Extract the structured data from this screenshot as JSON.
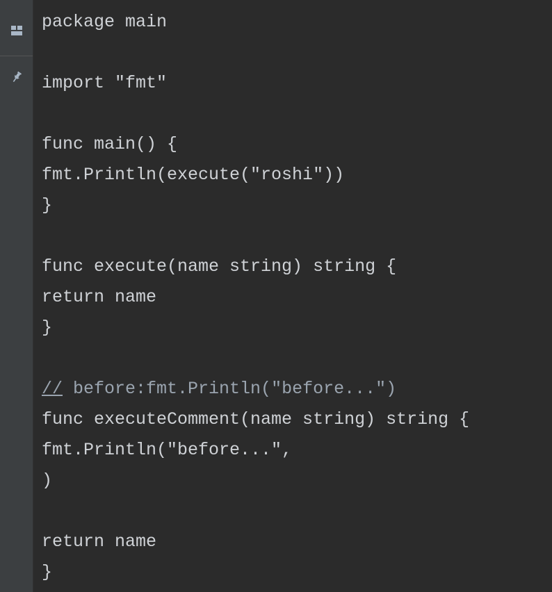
{
  "gutter": {
    "layout_icon": "layout-icon",
    "pin_icon": "pin-icon"
  },
  "code": {
    "l1": "package main",
    "l2": "",
    "l3": "import \"fmt\"",
    "l4": "",
    "l5": "func main() {",
    "l6": "fmt.Println(execute(\"roshi\"))",
    "l7": "}",
    "l8": "",
    "l9": "func execute(name string) string {",
    "l10": "return name",
    "l11": "}",
    "l12": "",
    "l13_slash": "//",
    "l13_rest": " before:fmt.Println(\"before...\")",
    "l14": "func executeComment(name string) string {",
    "l15": "fmt.Println(\"before...\",",
    "l16": ")",
    "l17": "",
    "l18": "return name",
    "l19": "}"
  }
}
